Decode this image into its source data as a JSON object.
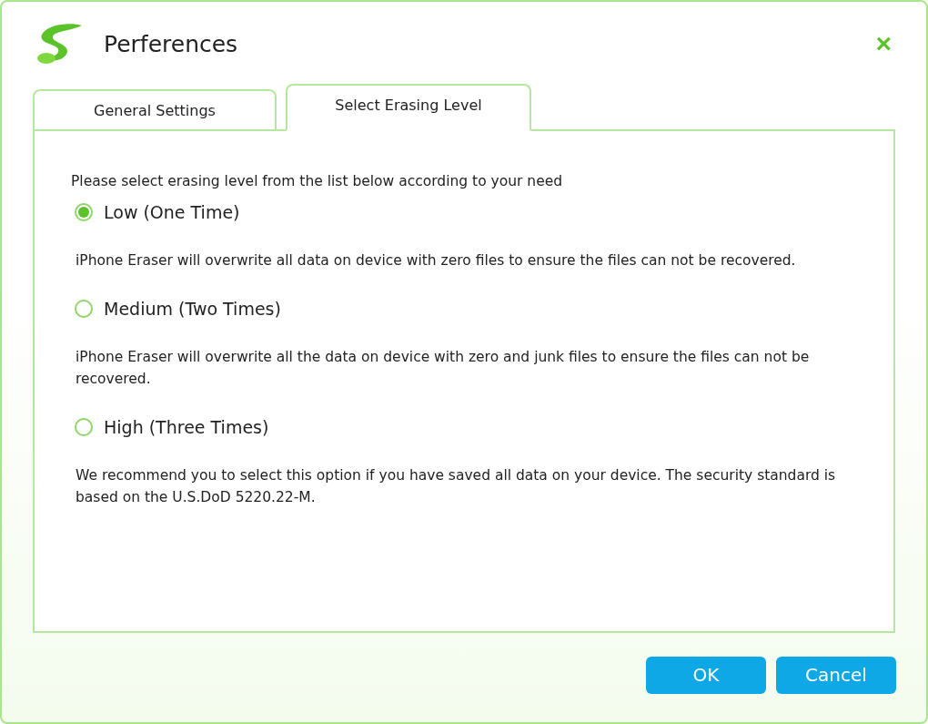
{
  "window": {
    "title": "Perferences",
    "close": "×"
  },
  "tabs": [
    {
      "label": "General Settings",
      "selected": false
    },
    {
      "label": "Select Erasing Level",
      "selected": true
    }
  ],
  "intro": "Please select erasing level from the list below according to your need",
  "levels": [
    {
      "label": "Low (One Time)",
      "selected": true,
      "description": "iPhone Eraser will overwrite all data on device with zero files to ensure the files can not be recovered."
    },
    {
      "label": "Medium (Two Times)",
      "selected": false,
      "description": "iPhone Eraser will overwrite all the data on device with zero and junk files to ensure the files can not be recovered."
    },
    {
      "label": "High (Three Times)",
      "selected": false,
      "description": "We recommend you to select this option if you have saved all data on your device. The security standard is based on the U.S.DoD 5220.22-M."
    }
  ],
  "buttons": [
    "OK",
    "Cancel"
  ]
}
